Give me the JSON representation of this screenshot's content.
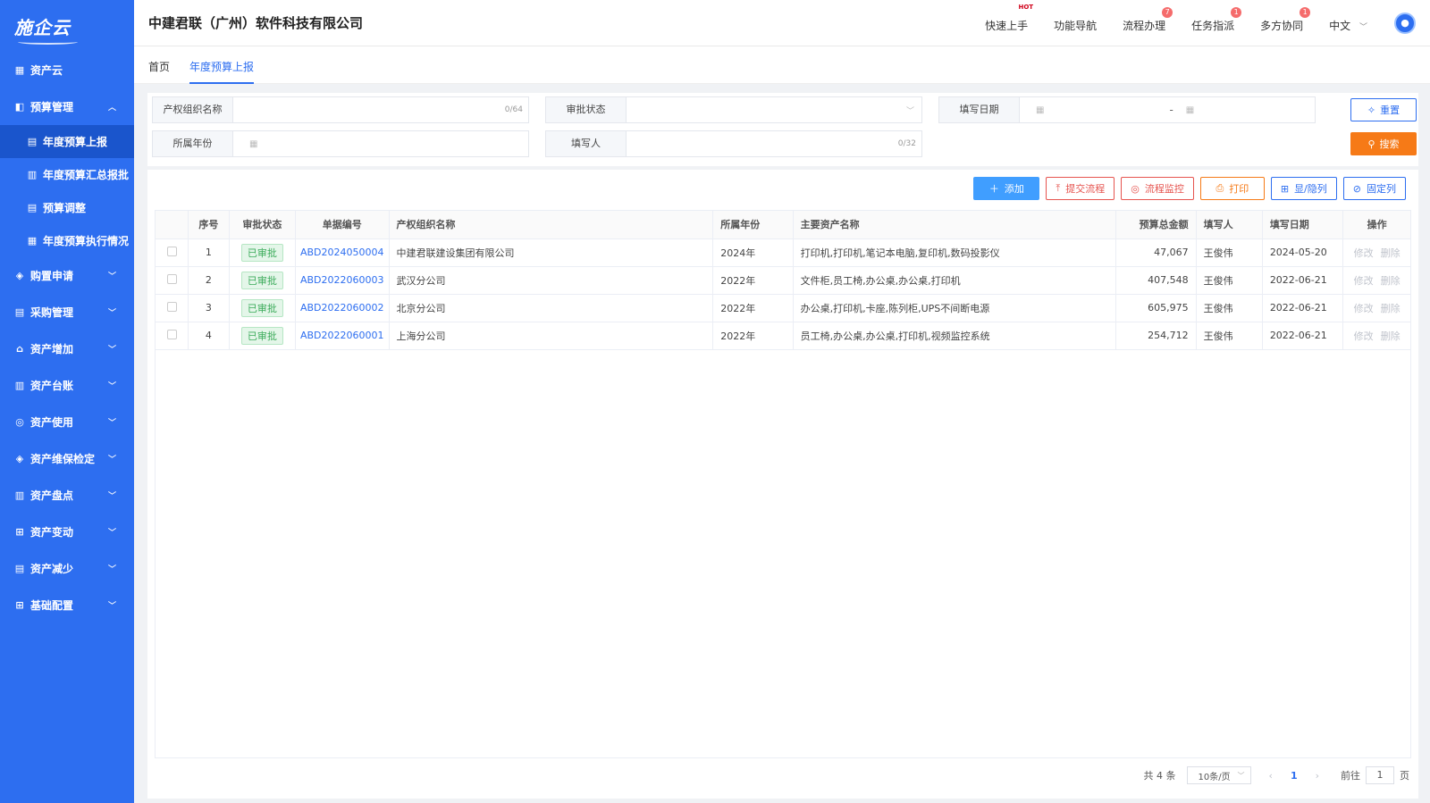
{
  "sidebar": {
    "logo": "施企云",
    "items": [
      {
        "label": "资产云",
        "icon": "grid-icon",
        "expanded": false
      },
      {
        "label": "预算管理",
        "icon": "budget-icon",
        "expanded": true
      },
      {
        "label": "购置申请",
        "icon": "cube-icon",
        "expanded": false
      },
      {
        "label": "采购管理",
        "icon": "clipboard-icon",
        "expanded": false
      },
      {
        "label": "资产增加",
        "icon": "home-icon",
        "expanded": false
      },
      {
        "label": "资产台账",
        "icon": "ledger-icon",
        "expanded": false
      },
      {
        "label": "资产使用",
        "icon": "layers-icon",
        "expanded": false
      },
      {
        "label": "资产维保检定",
        "icon": "cube-icon",
        "expanded": false
      },
      {
        "label": "资产盘点",
        "icon": "ledger-icon",
        "expanded": false
      },
      {
        "label": "资产变动",
        "icon": "apps-icon",
        "expanded": false
      },
      {
        "label": "资产减少",
        "icon": "clipboard-icon",
        "expanded": false
      },
      {
        "label": "基础配置",
        "icon": "apps-icon",
        "expanded": false
      }
    ],
    "budget_sub": [
      {
        "label": "年度预算上报",
        "active": true
      },
      {
        "label": "年度预算汇总报批",
        "active": false
      },
      {
        "label": "预算调整",
        "active": false
      },
      {
        "label": "年度预算执行情况",
        "active": false
      }
    ]
  },
  "header": {
    "company": "中建君联（广州）软件科技有限公司",
    "nav": [
      {
        "label": "快速上手",
        "badge": "",
        "hot": "HOT"
      },
      {
        "label": "功能导航",
        "badge": "",
        "hot": ""
      },
      {
        "label": "流程办理",
        "badge": "7",
        "hot": ""
      },
      {
        "label": "任务指派",
        "badge": "1",
        "hot": ""
      },
      {
        "label": "多方协同",
        "badge": "1",
        "hot": ""
      }
    ],
    "language": "中文"
  },
  "tabs": [
    {
      "label": "首页",
      "active": false
    },
    {
      "label": "年度预算上报",
      "active": true
    }
  ],
  "filter": {
    "org_label": "产权组织名称",
    "org_count": "0/64",
    "status_label": "审批状态",
    "date_label": "填写日期",
    "date_sep": "-",
    "year_label": "所属年份",
    "filler_label": "填写人",
    "filler_count": "0/32",
    "reset": "重置",
    "search": "搜索"
  },
  "toolbar": {
    "add": "添加",
    "submit": "提交流程",
    "monitor": "流程监控",
    "print": "打印",
    "toggle_cols": "显/隐列",
    "fix_cols": "固定列"
  },
  "table": {
    "headers": [
      "",
      "序号",
      "审批状态",
      "单据编号",
      "产权组织名称",
      "所属年份",
      "主要资产名称",
      "预算总金额",
      "填写人",
      "填写日期",
      "操作"
    ],
    "rows": [
      {
        "no": "1",
        "status": "已审批",
        "code": "ABD2024050004",
        "org": "中建君联建设集团有限公司",
        "year": "2024年",
        "assets": "打印机,打印机,笔记本电脑,复印机,数码投影仪",
        "amount": "47,067",
        "filler": "王俊伟",
        "date": "2024-05-20",
        "edit": "修改",
        "del": "删除"
      },
      {
        "no": "2",
        "status": "已审批",
        "code": "ABD2022060003",
        "org": "武汉分公司",
        "year": "2022年",
        "assets": "文件柜,员工椅,办公桌,办公桌,打印机",
        "amount": "407,548",
        "filler": "王俊伟",
        "date": "2022-06-21",
        "edit": "修改",
        "del": "删除"
      },
      {
        "no": "3",
        "status": "已审批",
        "code": "ABD2022060002",
        "org": "北京分公司",
        "year": "2022年",
        "assets": "办公桌,打印机,卡座,陈列柜,UPS不间断电源",
        "amount": "605,975",
        "filler": "王俊伟",
        "date": "2022-06-21",
        "edit": "修改",
        "del": "删除"
      },
      {
        "no": "4",
        "status": "已审批",
        "code": "ABD2022060001",
        "org": "上海分公司",
        "year": "2022年",
        "assets": "员工椅,办公桌,办公桌,打印机,视频监控系统",
        "amount": "254,712",
        "filler": "王俊伟",
        "date": "2022-06-21",
        "edit": "修改",
        "del": "删除"
      }
    ]
  },
  "pager": {
    "total": "共 4 条",
    "page_size": "10条/页",
    "current": "1",
    "goto_label": "前往",
    "goto_value": "1",
    "goto_suffix": "页"
  }
}
